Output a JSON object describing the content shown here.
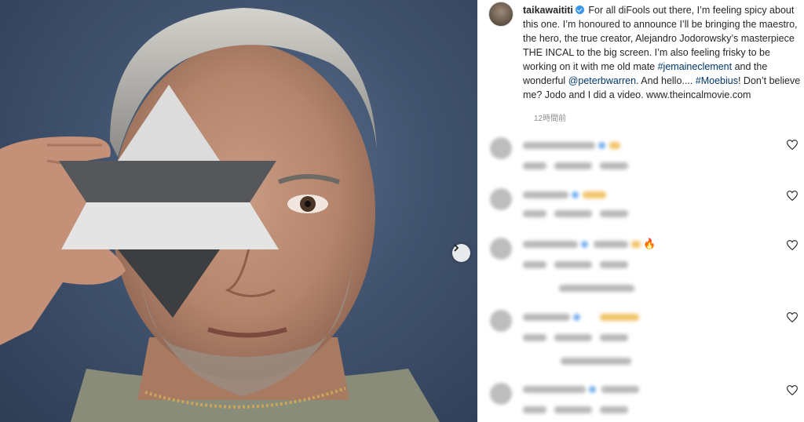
{
  "post": {
    "username": "taikawaititi",
    "caption_intro": "For all diFools out there, I’m feeling spicy about this one. I’m honoured to announce I’ll be bringing the maestro, the hero, the true creator, Alejandro Jodorowsky’s masterpiece THE INCAL to the big screen. I’m also feeling frisky to be working on it with me old mate ",
    "mention_1": "#jemaineclement",
    "caption_mid_1": " and the wonderful ",
    "mention_2": "@peterbwarren",
    "caption_mid_2": ". And hello.... ",
    "hashtag": "#Moebius",
    "caption_end": "! Don’t believe me? Jodo and I did a video. www.theincalmovie.com",
    "timestamp": "12時間前"
  },
  "photo": {
    "next_icon": "chevron-right-icon"
  },
  "comments": {
    "fire_emoji": "🔥",
    "like_icon": "heart-outline-icon"
  },
  "colors": {
    "link": "#00376b",
    "verified": "#3897f0",
    "muted": "#8e8e8e",
    "photo_background": "#41536e"
  }
}
